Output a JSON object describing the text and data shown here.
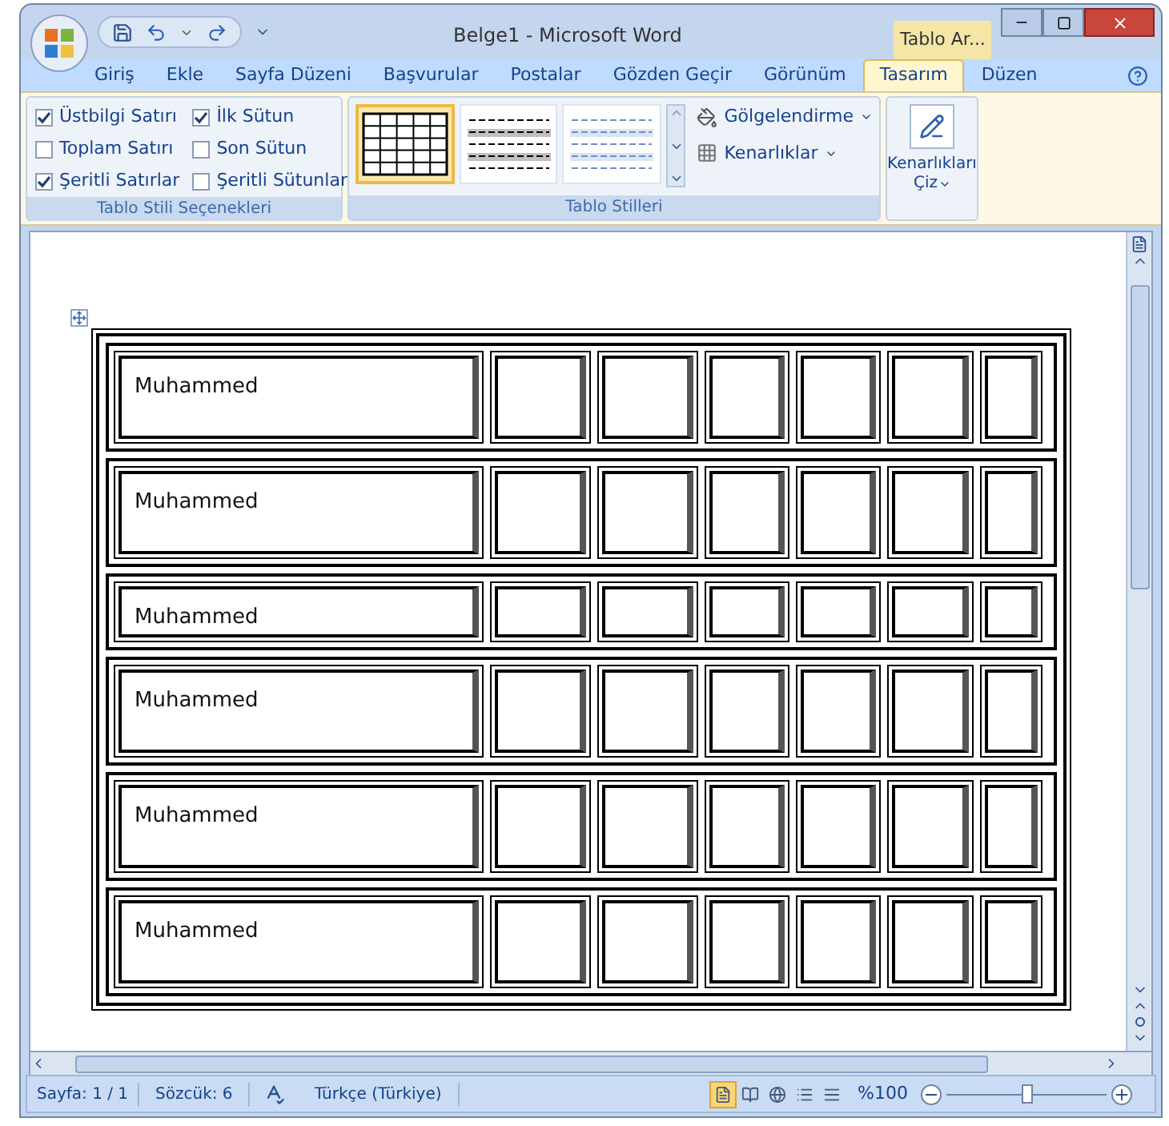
{
  "window": {
    "title": "Belge1 - Microsoft Word",
    "context_tab": "Tablo Ar..."
  },
  "tabs": [
    {
      "label": "Giriş",
      "selected": false
    },
    {
      "label": "Ekle",
      "selected": false
    },
    {
      "label": "Sayfa Düzeni",
      "selected": false
    },
    {
      "label": "Başvurular",
      "selected": false
    },
    {
      "label": "Postalar",
      "selected": false
    },
    {
      "label": "Gözden Geçir",
      "selected": false
    },
    {
      "label": "Görünüm",
      "selected": false
    },
    {
      "label": "Tasarım",
      "selected": true
    },
    {
      "label": "Düzen",
      "selected": false
    }
  ],
  "style_options": {
    "label": "Tablo Stili Seçenekleri",
    "options": [
      {
        "label": "Üstbilgi Satırı",
        "checked": true
      },
      {
        "label": "İlk Sütun",
        "checked": true
      },
      {
        "label": "Toplam Satırı",
        "checked": false
      },
      {
        "label": "Son Sütun",
        "checked": false
      },
      {
        "label": "Şeritli Satırlar",
        "checked": true
      },
      {
        "label": "Şeritli Sütunlar",
        "checked": false
      }
    ]
  },
  "table_styles": {
    "label": "Tablo Stilleri",
    "styles": [
      {
        "kind": "grid",
        "selected": true
      },
      {
        "kind": "shaded",
        "selected": false
      },
      {
        "kind": "light",
        "selected": false
      }
    ],
    "shading": "Gölgelendirme",
    "borders": "Kenarlıklar"
  },
  "draw_borders": {
    "label": "Kenarlıkları",
    "label2": "Çiz"
  },
  "table": {
    "rows": [
      {
        "text": "Muhammed",
        "kind": "tall"
      },
      {
        "text": "Muhammed",
        "kind": "tall"
      },
      {
        "text": "Muhammed",
        "kind": "short"
      },
      {
        "text": "Muhammed",
        "kind": "tall"
      },
      {
        "text": "Muhammed",
        "kind": "tall"
      },
      {
        "text": "Muhammed",
        "kind": "tall"
      }
    ]
  },
  "status_bar": {
    "page": "Sayfa: 1 / 1",
    "words": "Sözcük: 6",
    "language": "Türkçe (Türkiye)",
    "views": [
      {
        "selected": true
      },
      {
        "selected": false
      },
      {
        "selected": false
      },
      {
        "selected": false
      },
      {
        "selected": false
      }
    ],
    "zoom": "%100",
    "zoom_slider": {
      "level": 0.5
    }
  }
}
